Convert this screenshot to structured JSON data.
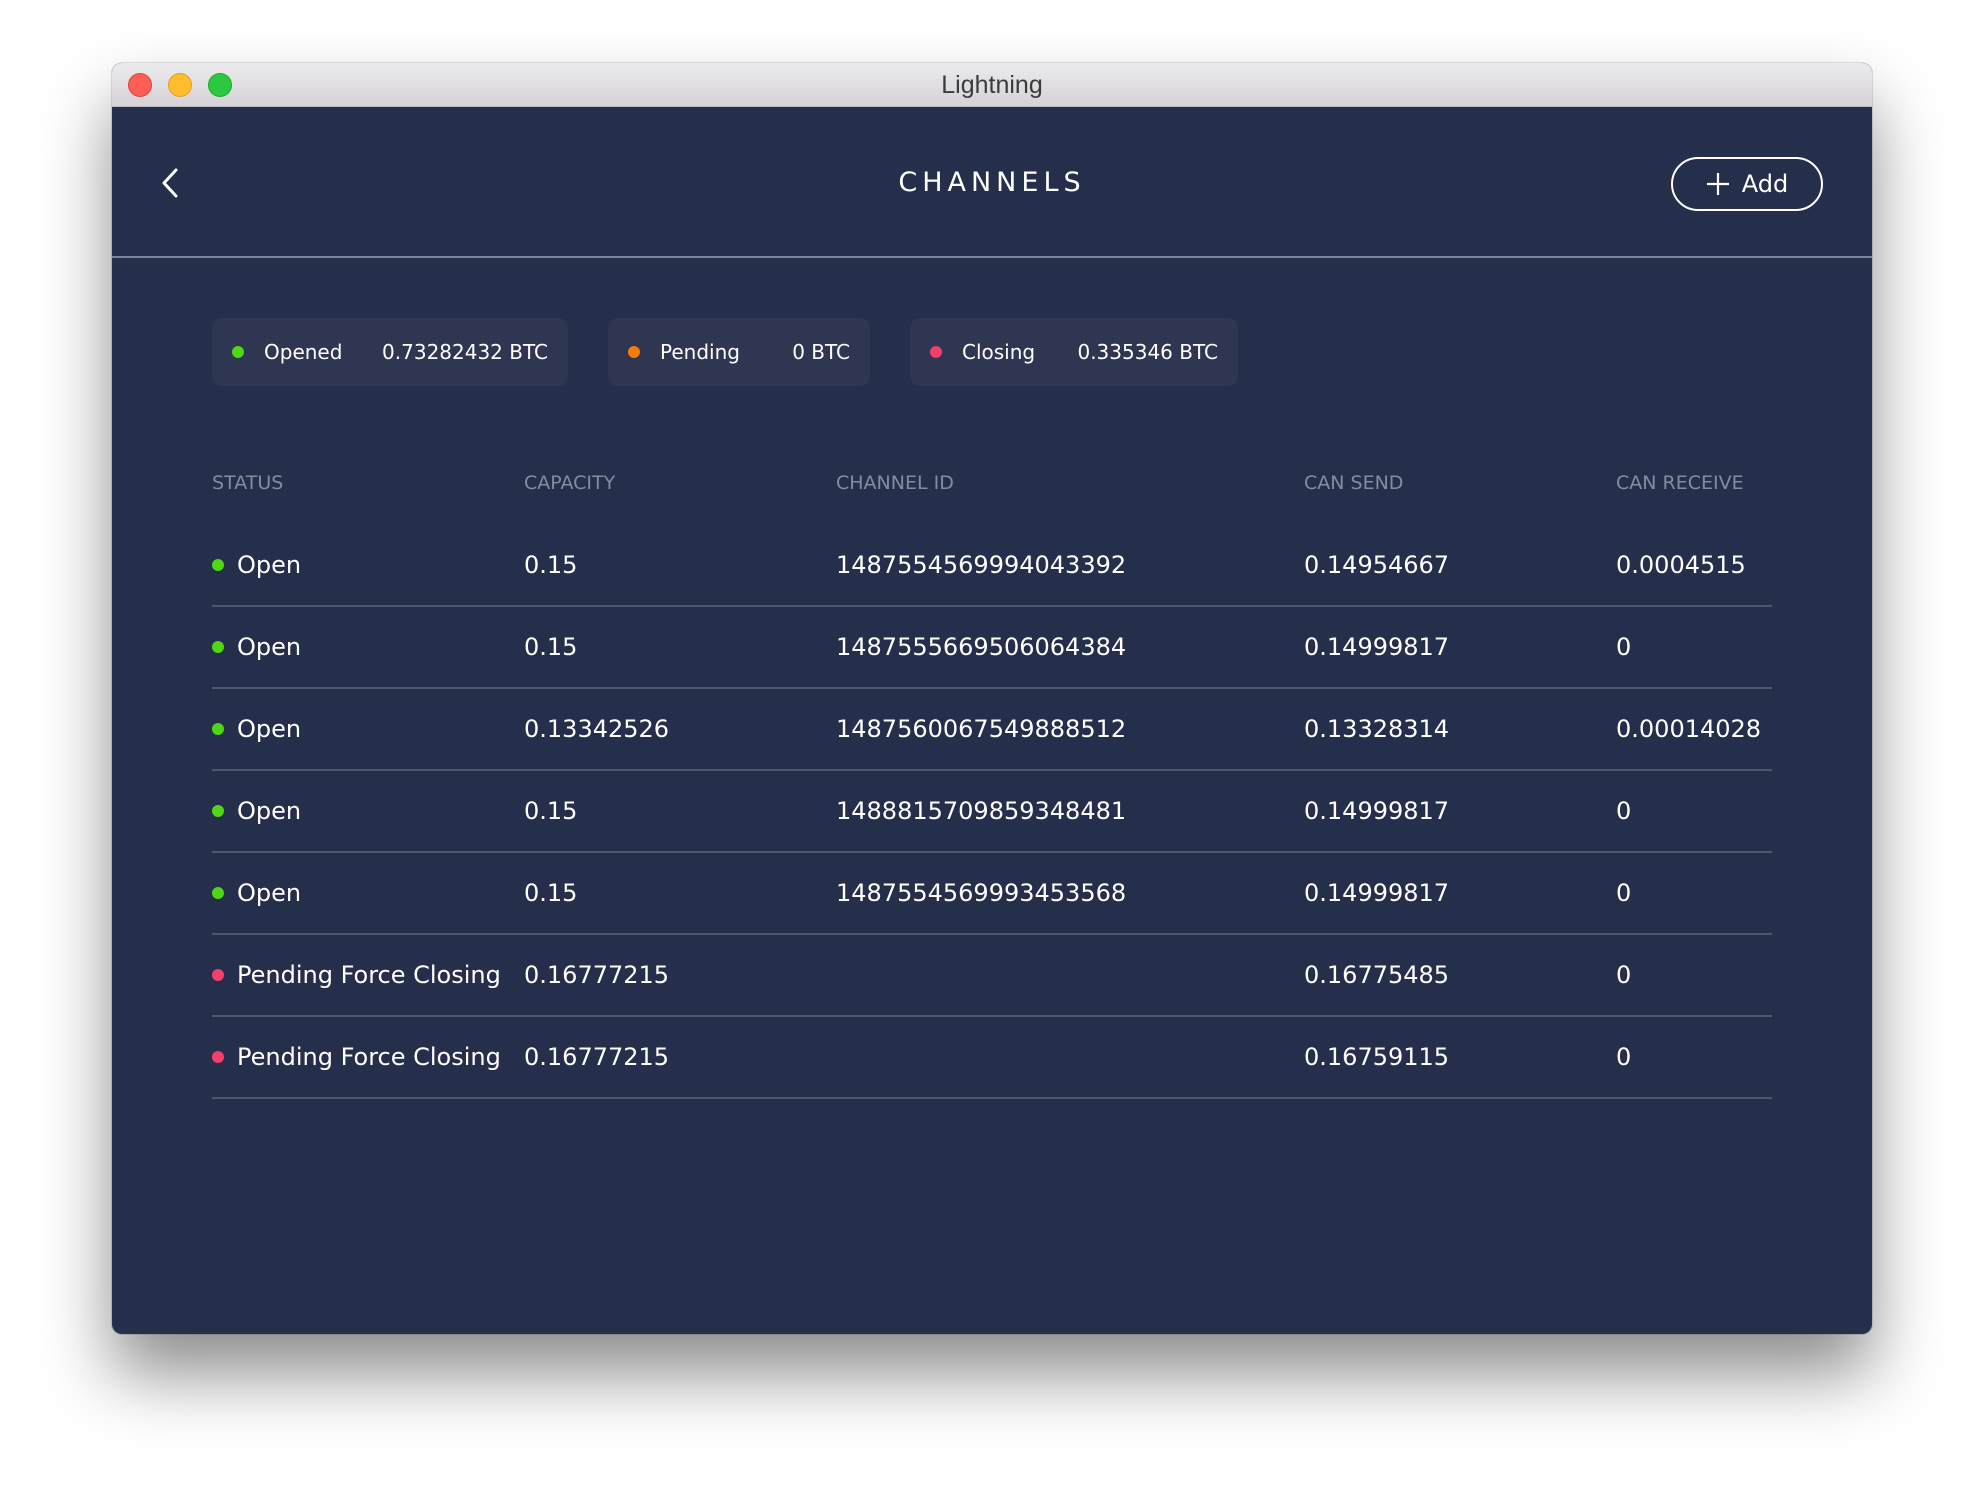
{
  "window": {
    "title": "Lightning"
  },
  "header": {
    "title": "CHANNELS",
    "add_label": "Add"
  },
  "colors": {
    "background": "#252E4A",
    "card": "#2E3651",
    "open": "#4ED712",
    "pending": "#F77B08",
    "closing": "#F2406C"
  },
  "summary": [
    {
      "label": "Opened",
      "value": "0.73282432 BTC",
      "status": "open"
    },
    {
      "label": "Pending",
      "value": "0 BTC",
      "status": "pending"
    },
    {
      "label": "Closing",
      "value": "0.335346 BTC",
      "status": "closing"
    }
  ],
  "table": {
    "columns": [
      "STATUS",
      "CAPACITY",
      "CHANNEL ID",
      "CAN SEND",
      "CAN RECEIVE"
    ],
    "rows": [
      {
        "status": "Open",
        "state": "open",
        "capacity": "0.15",
        "channel_id": "1487554569994043392",
        "can_send": "0.14954667",
        "can_receive": "0.0004515"
      },
      {
        "status": "Open",
        "state": "open",
        "capacity": "0.15",
        "channel_id": "1487555669506064384",
        "can_send": "0.14999817",
        "can_receive": "0"
      },
      {
        "status": "Open",
        "state": "open",
        "capacity": "0.13342526",
        "channel_id": "1487560067549888512",
        "can_send": "0.13328314",
        "can_receive": "0.00014028"
      },
      {
        "status": "Open",
        "state": "open",
        "capacity": "0.15",
        "channel_id": "1488815709859348481",
        "can_send": "0.14999817",
        "can_receive": "0"
      },
      {
        "status": "Open",
        "state": "open",
        "capacity": "0.15",
        "channel_id": "1487554569993453568",
        "can_send": "0.14999817",
        "can_receive": "0"
      },
      {
        "status": "Pending Force Closing",
        "state": "closing",
        "capacity": "0.16777215",
        "channel_id": "",
        "can_send": "0.16775485",
        "can_receive": "0"
      },
      {
        "status": "Pending Force Closing",
        "state": "closing",
        "capacity": "0.16777215",
        "channel_id": "",
        "can_send": "0.16759115",
        "can_receive": "0"
      }
    ]
  }
}
